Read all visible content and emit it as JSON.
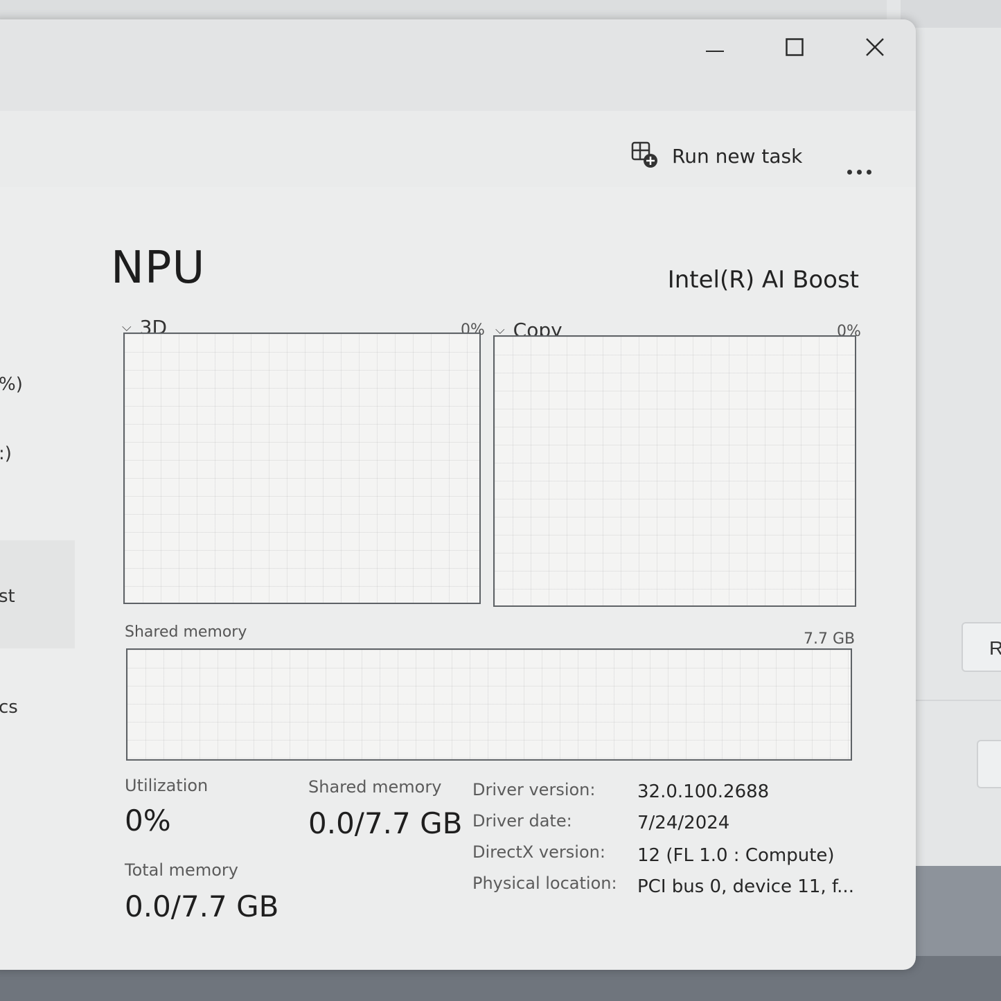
{
  "window": {
    "controls": {
      "minimize_icon": "minimize-icon",
      "maximize_icon": "maximize-icon",
      "close_icon": "close-icon"
    }
  },
  "toolbar": {
    "run_new_task_label": "Run new task",
    "more_icon": "more-options-icon"
  },
  "sidebar": {
    "fragments": [
      "%)",
      ":)",
      "st",
      "cs"
    ]
  },
  "header": {
    "title": "NPU",
    "device_name": "Intel(R) AI Boost"
  },
  "graphs": {
    "engine1": {
      "label": "3D",
      "value": "0%"
    },
    "engine2": {
      "label": "Copy",
      "value": "0%"
    },
    "shared_memory": {
      "label": "Shared memory",
      "max": "7.7 GB"
    }
  },
  "stats": {
    "utilization": {
      "label": "Utilization",
      "value": "0%"
    },
    "shared_memory": {
      "label": "Shared memory",
      "value": "0.0/7.7 GB"
    },
    "total_memory": {
      "label": "Total memory",
      "value": "0.0/7.7 GB"
    }
  },
  "info": [
    {
      "label": "Driver version:",
      "value": "32.0.100.2688"
    },
    {
      "label": "Driver date:",
      "value": "7/24/2024"
    },
    {
      "label": "DirectX version:",
      "value": "12 (FL 1.0 : Compute)"
    },
    {
      "label": "Physical location:",
      "value": "PCI bus 0, device 11, f..."
    }
  ],
  "background": {
    "partial_button_label": "R"
  }
}
